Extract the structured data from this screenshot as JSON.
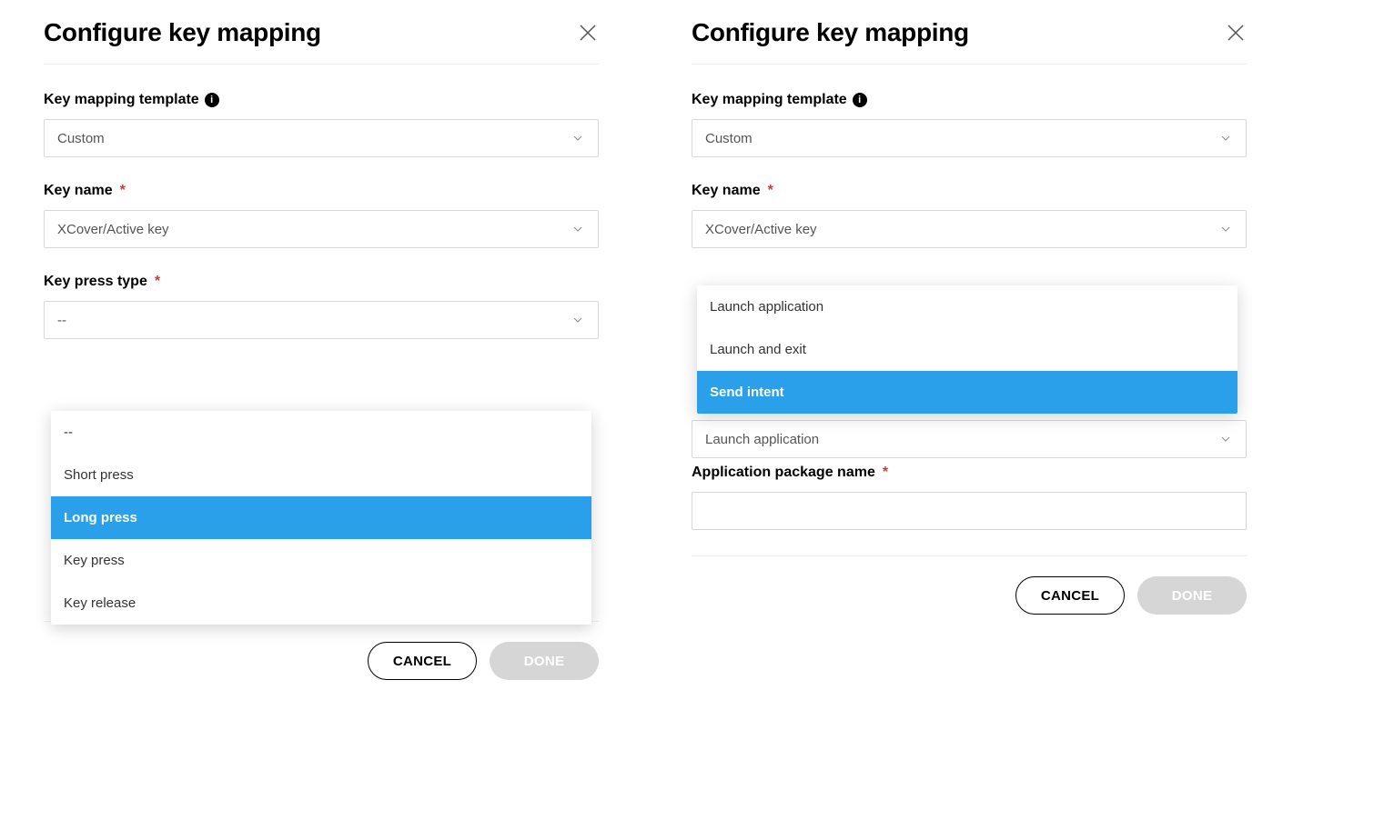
{
  "left": {
    "title": "Configure key mapping",
    "template_label": "Key mapping template",
    "template_value": "Custom",
    "key_name_label": "Key name",
    "key_name_value": "XCover/Active key",
    "press_type_label": "Key press type",
    "press_type_value": "--",
    "dropdown": {
      "items": [
        "--",
        "Short press",
        "Long press",
        "Key press",
        "Key release"
      ],
      "highlighted": "Long press"
    },
    "hint_letters": [
      "",
      ""
    ],
    "buttons": {
      "cancel": "CANCEL",
      "done": "DONE"
    }
  },
  "right": {
    "title": "Configure key mapping",
    "template_label": "Key mapping template",
    "template_value": "Custom",
    "key_name_label": "Key name",
    "key_name_value": "XCover/Active key",
    "dropdown": {
      "items": [
        "Launch application",
        "Launch and exit",
        "Send intent"
      ],
      "highlighted": "Send intent"
    },
    "underlying_select_value": "Launch application",
    "app_pkg_label": "Application package name",
    "app_pkg_value": "",
    "hint_letters": [
      "",
      ""
    ],
    "buttons": {
      "cancel": "CANCEL",
      "done": "DONE"
    }
  }
}
